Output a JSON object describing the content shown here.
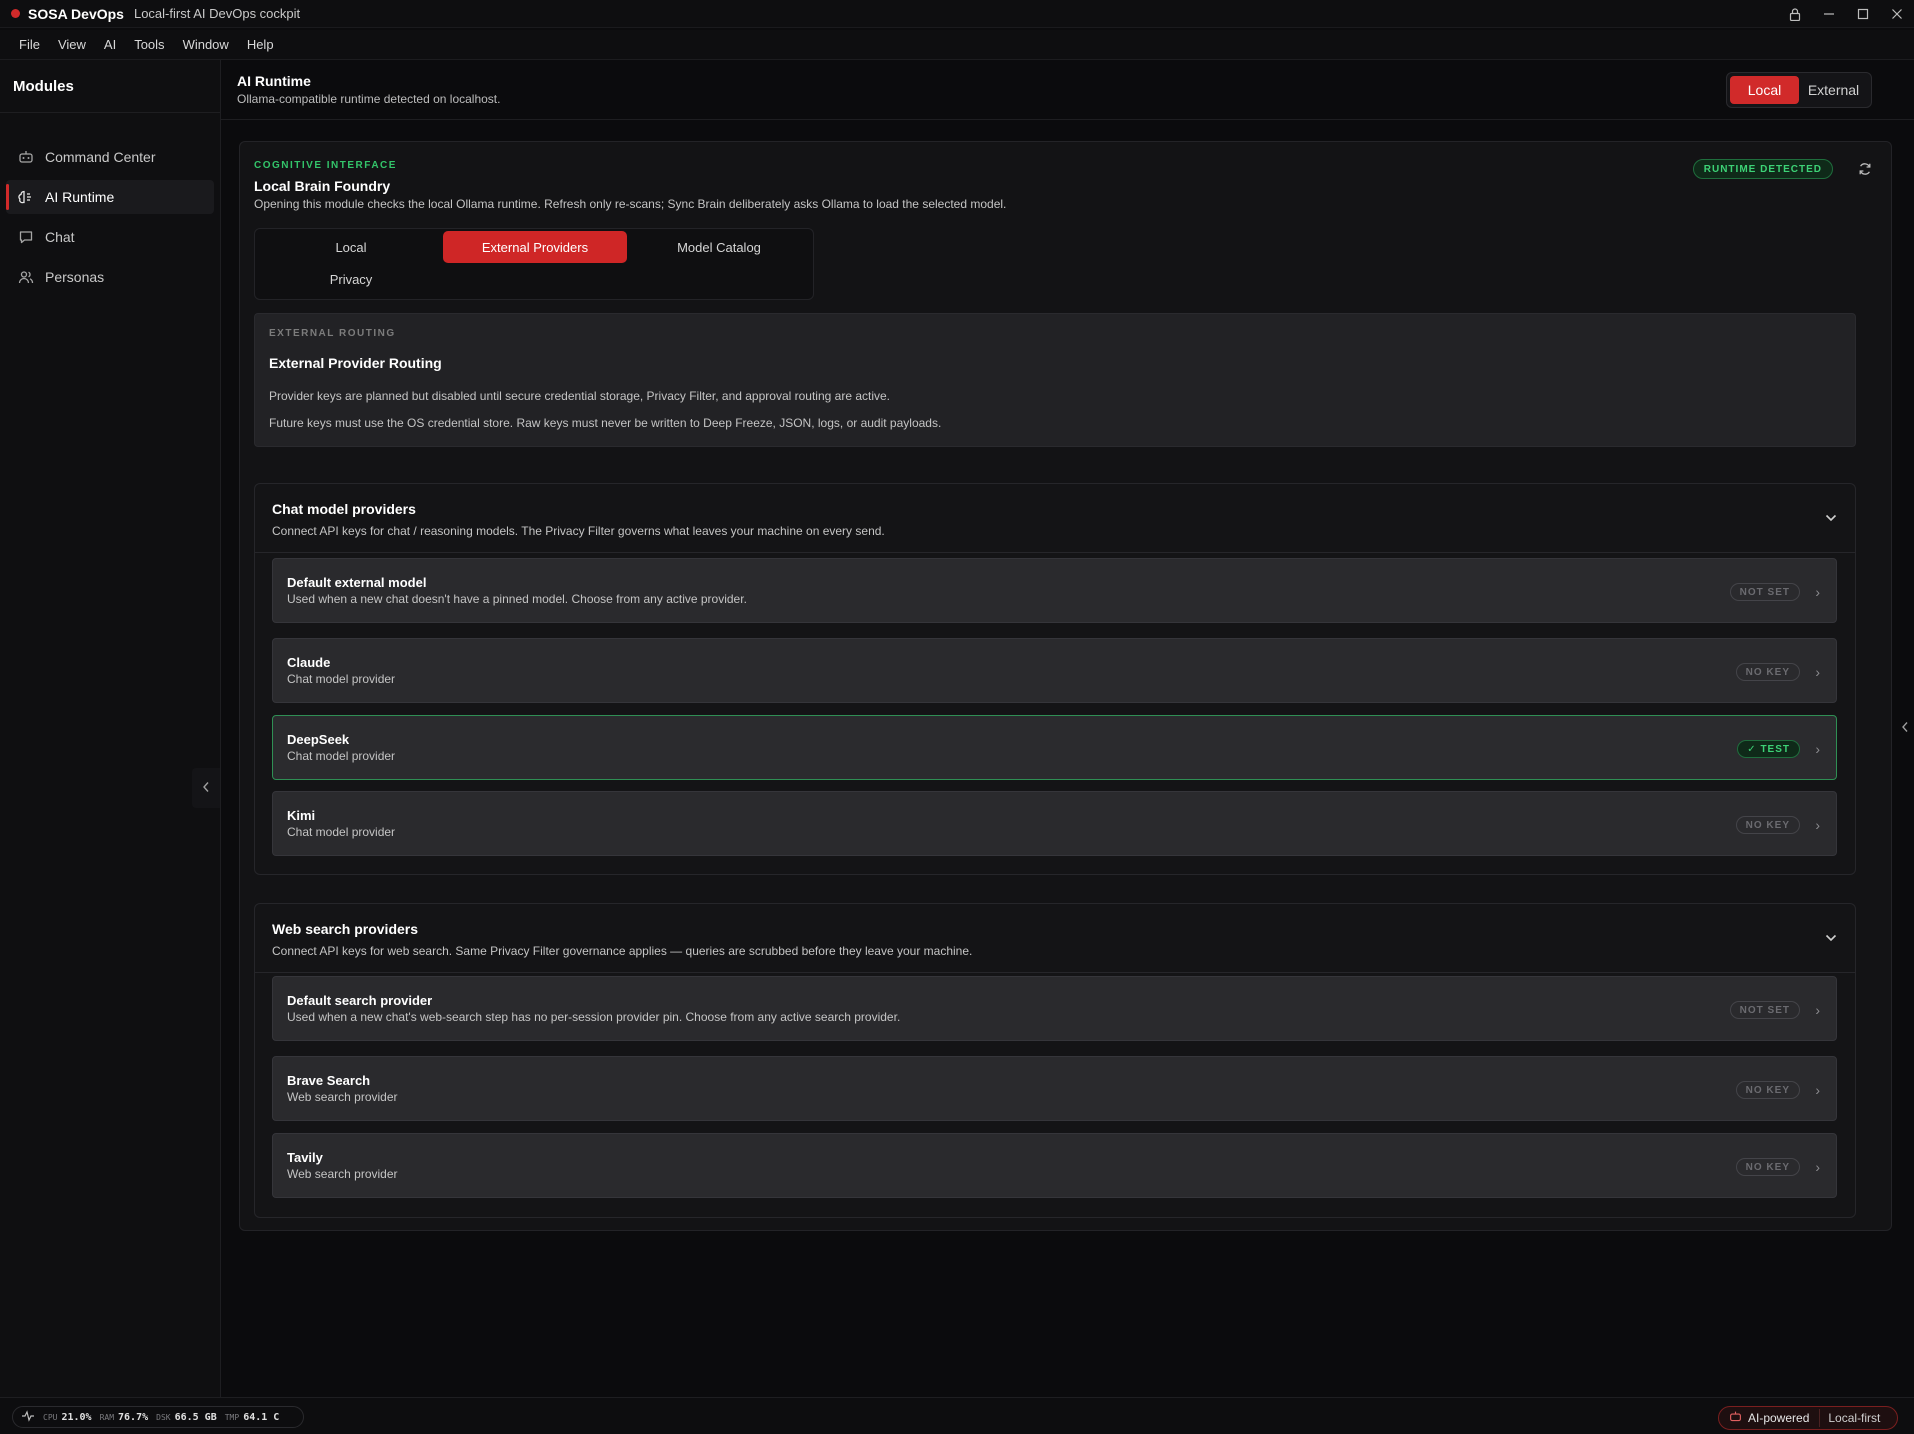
{
  "app": {
    "name": "SOSA DevOps",
    "tagline": "Local-first AI DevOps cockpit"
  },
  "menu": [
    "File",
    "View",
    "AI",
    "Tools",
    "Window",
    "Help"
  ],
  "sidebar": {
    "title": "Modules",
    "items": [
      {
        "label": "Command Center",
        "icon": "robot-icon"
      },
      {
        "label": "AI Runtime",
        "icon": "brain-icon",
        "active": true
      },
      {
        "label": "Chat",
        "icon": "chat-bubble-icon"
      },
      {
        "label": "Personas",
        "icon": "users-icon"
      }
    ]
  },
  "header": {
    "title": "AI Runtime",
    "subtitle": "Ollama-compatible runtime detected on localhost.",
    "mode_local": "Local",
    "mode_external": "External"
  },
  "card": {
    "eyebrow": "COGNITIVE INTERFACE",
    "title": "Local Brain Foundry",
    "desc": "Opening this module checks the local Ollama runtime. Refresh only re-scans; Sync Brain deliberately asks Ollama to load the selected model.",
    "badge": "RUNTIME DETECTED",
    "tabs": [
      "Local",
      "External Providers",
      "Model Catalog",
      "Privacy"
    ],
    "active_tab": "External Providers"
  },
  "routing": {
    "eyebrow": "EXTERNAL ROUTING",
    "title": "External Provider Routing",
    "line1": "Provider keys are planned but disabled until secure credential storage, Privacy Filter, and approval routing are active.",
    "line2": "Future keys must use the OS credential store. Raw keys must never be written to Deep Freeze, JSON, logs, or audit payloads."
  },
  "chat_section": {
    "title": "Chat model providers",
    "desc": "Connect API keys for chat / reasoning models. The Privacy Filter governs what leaves your machine on every send.",
    "rows": [
      {
        "title": "Default external model",
        "sub": "Used when a new chat doesn't have a pinned model. Choose from any active provider.",
        "badge": "NOT SET"
      },
      {
        "title": "Claude",
        "sub": "Chat model provider",
        "badge": "NO KEY"
      },
      {
        "title": "DeepSeek",
        "sub": "Chat model provider",
        "badge": "✓ TEST",
        "selected": true
      },
      {
        "title": "Kimi",
        "sub": "Chat model provider",
        "badge": "NO KEY"
      }
    ]
  },
  "search_section": {
    "title": "Web search providers",
    "desc": "Connect API keys for web search. Same Privacy Filter governance applies — queries are scrubbed before they leave your machine.",
    "rows": [
      {
        "title": "Default search provider",
        "sub": "Used when a new chat's web-search step has no per-session provider pin. Choose from any active search provider.",
        "badge": "NOT SET"
      },
      {
        "title": "Brave Search",
        "sub": "Web search provider",
        "badge": "NO KEY"
      },
      {
        "title": "Tavily",
        "sub": "Web search provider",
        "badge": "NO KEY"
      }
    ]
  },
  "status": {
    "cpu_label": "CPU",
    "cpu": "21.0%",
    "ram_label": "RAM",
    "ram": "76.7%",
    "dsk_label": "DSK",
    "dsk": "66.5 GB",
    "tmp_label": "TMP",
    "tmp": "64.1 C",
    "ai_label": "AI-powered",
    "local_label": "Local-first"
  },
  "colors": {
    "accent_red": "#d12a2a",
    "accent_green": "#3dd276"
  }
}
